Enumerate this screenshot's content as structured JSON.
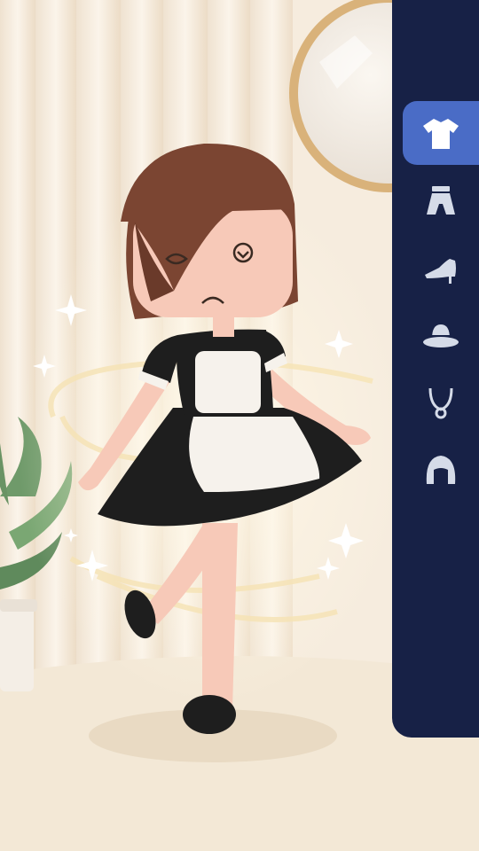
{
  "scene": "dress-up",
  "character": {
    "outfit": "maid-dress",
    "hair_color": "#7b4532",
    "skin_color": "#f7c9b8",
    "dress_color": "#1e1e1e",
    "apron_color": "#f6f2ec"
  },
  "sidebar": {
    "background": "#172146",
    "active_color": "#4a6cc6",
    "icon_color": "#d5dbe8",
    "items": [
      {
        "name": "top",
        "icon": "shirt-icon",
        "active": true
      },
      {
        "name": "bottom",
        "icon": "skirt-icon",
        "active": false
      },
      {
        "name": "shoes",
        "icon": "heel-shoe-icon",
        "active": false
      },
      {
        "name": "hat",
        "icon": "hat-icon",
        "active": false
      },
      {
        "name": "necklace",
        "icon": "necklace-icon",
        "active": false
      },
      {
        "name": "hair",
        "icon": "hair-icon",
        "active": false
      }
    ]
  }
}
